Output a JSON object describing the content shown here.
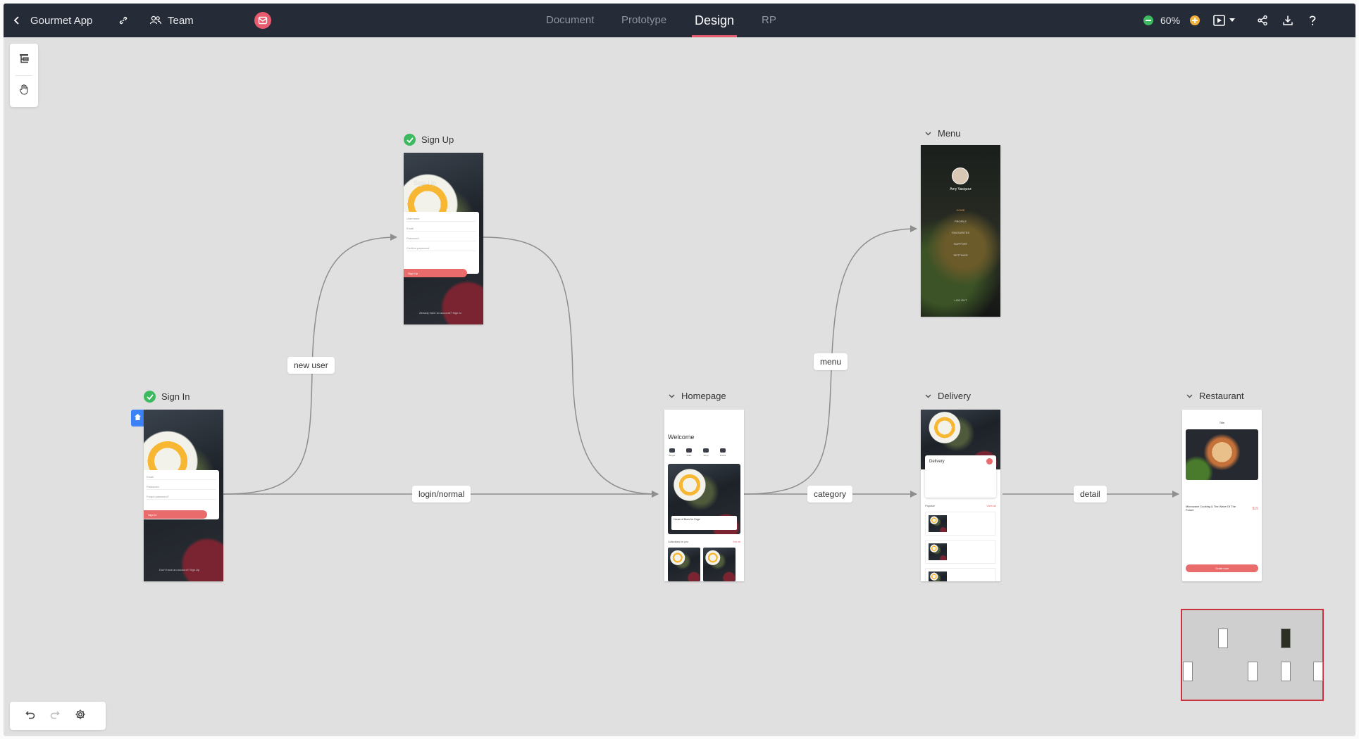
{
  "app": {
    "title": "Gourmet App",
    "team_label": "Team"
  },
  "tabs": [
    {
      "label": "Document",
      "active": false
    },
    {
      "label": "Prototype",
      "active": false
    },
    {
      "label": "Design",
      "active": true
    },
    {
      "label": "RP",
      "active": false
    }
  ],
  "zoom": {
    "value": "60%"
  },
  "colors": {
    "topbar": "#262b38",
    "accent": "#e85a6e",
    "canvas": "#e0e0e0",
    "check": "#3dba5f",
    "zoom_out": "#3dba5f",
    "zoom_in": "#f5b13d"
  },
  "icons": {
    "back": "chevron-left-icon",
    "link": "link-icon",
    "team": "team-icon",
    "avatar": "mail-avatar-icon",
    "preview": "play-icon",
    "share": "share-icon",
    "download": "download-icon",
    "help": "help-icon",
    "layers": "layers-icon",
    "hand": "hand-icon",
    "undo": "undo-icon",
    "redo": "redo-icon",
    "settings": "gear-icon"
  },
  "screens": {
    "signin": {
      "title": "Sign In",
      "status": "done",
      "fields": [
        "Email",
        "Password",
        "Forgot password?"
      ],
      "button": "Sign In",
      "footer": "Don't have an account?   Sign Up"
    },
    "signup": {
      "title": "Sign Up",
      "status": "done",
      "heading": "Sign Up",
      "fields": [
        "Username",
        "Email",
        "Password",
        "Confirm password"
      ],
      "button": "Sign Up",
      "footer": "Already have an account?   Sign In"
    },
    "homepage": {
      "title": "Homepage",
      "welcome": "Welcome",
      "categories": [
        "Burger",
        "Rolls",
        "Soup",
        "Drinks"
      ],
      "card_title": "House of Buns for Onge",
      "section": "Collections for you",
      "see_all": "See all"
    },
    "menu": {
      "title": "Menu",
      "user": "Amy Vasquez",
      "items": [
        "HOME",
        "PROFILE",
        "FAVOURITES",
        "SUPPORT",
        "SETTINGS"
      ],
      "logout": "LOG OUT"
    },
    "delivery": {
      "title": "Delivery",
      "card_title": "Delivery",
      "popular": "Popular",
      "view_all": "View all"
    },
    "restaurant": {
      "title": "Restaurant",
      "header": "Title",
      "price": "$15",
      "dish": "Microwave Cooking & The Wave Of The Future",
      "button": "Order now"
    }
  },
  "connections": {
    "new_user": "new user",
    "login": "login/normal",
    "menu": "menu",
    "category": "category",
    "detail": "detail"
  }
}
